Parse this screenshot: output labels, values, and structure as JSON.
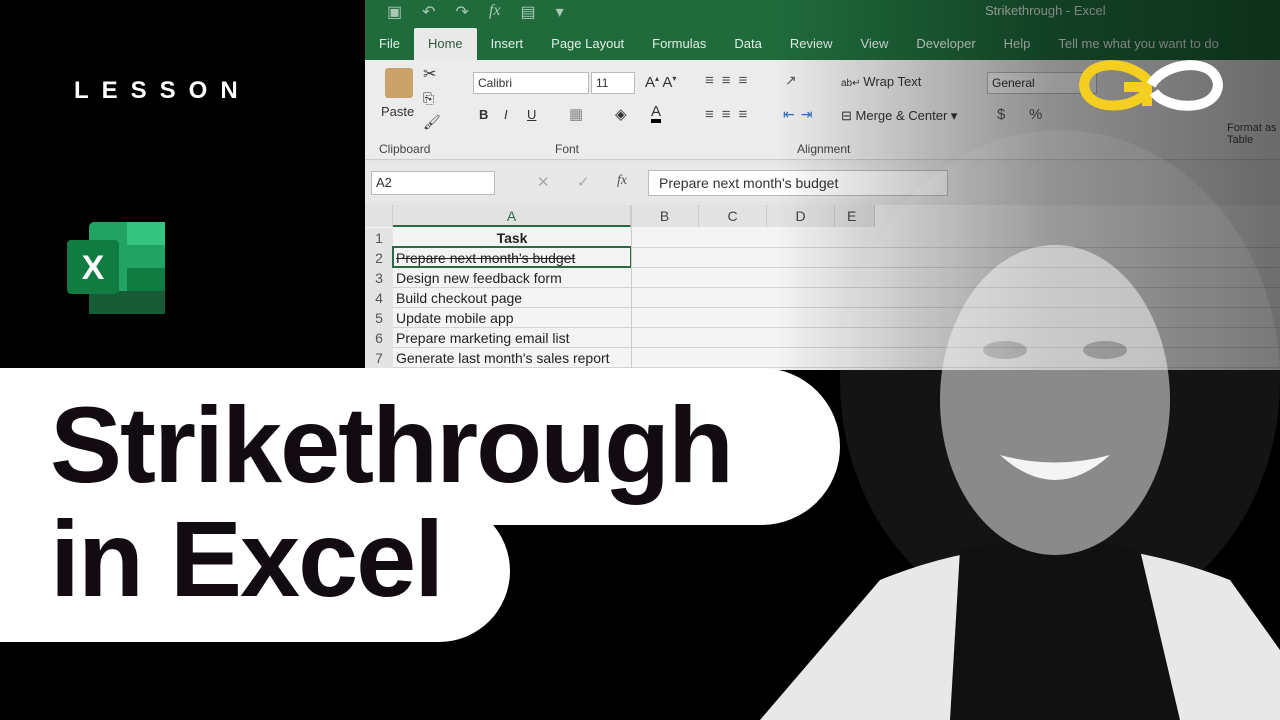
{
  "badge": {
    "lesson": "LESSON"
  },
  "excel": {
    "doc_title": "Strikethrough - Excel",
    "qat_icons": [
      "save-icon",
      "undo-icon",
      "redo-icon",
      "fx-icon",
      "form-icon",
      "customize-icon"
    ],
    "tabs": [
      "File",
      "Home",
      "Insert",
      "Page Layout",
      "Formulas",
      "Data",
      "Review",
      "View",
      "Developer",
      "Help",
      "Tell me what you want to do"
    ],
    "active_tab": "Home",
    "ribbon": {
      "paste": "Paste",
      "clipboard": "Clipboard",
      "font_name": "Calibri",
      "font_size": "11",
      "font": "Font",
      "bold": "B",
      "italic": "I",
      "underline": "U",
      "wrap_text": "Wrap Text",
      "merge_center": "Merge & Center",
      "alignment": "Alignment",
      "number_format": "General",
      "currency": "$",
      "percent": "%",
      "format_as_table": "Format as Table"
    },
    "name_box": "A2",
    "formula": "Prepare next month's budget",
    "columns": [
      "A",
      "B",
      "C",
      "D",
      "E"
    ],
    "rows": [
      {
        "n": "1",
        "text": "Task"
      },
      {
        "n": "2",
        "text": "Prepare next month's budget"
      },
      {
        "n": "3",
        "text": "Design new feedback form"
      },
      {
        "n": "4",
        "text": "Build checkout page"
      },
      {
        "n": "5",
        "text": "Update mobile app"
      },
      {
        "n": "6",
        "text": "Prepare marketing email list"
      },
      {
        "n": "7",
        "text": "Generate last month's sales report"
      }
    ]
  },
  "title": {
    "line1": "Strikethrough",
    "line2": "in Excel"
  },
  "colors": {
    "excel_green": "#1f6b3c",
    "logo_yellow": "#f5cf1f",
    "pill": "#ffffff",
    "background": "#000000"
  }
}
